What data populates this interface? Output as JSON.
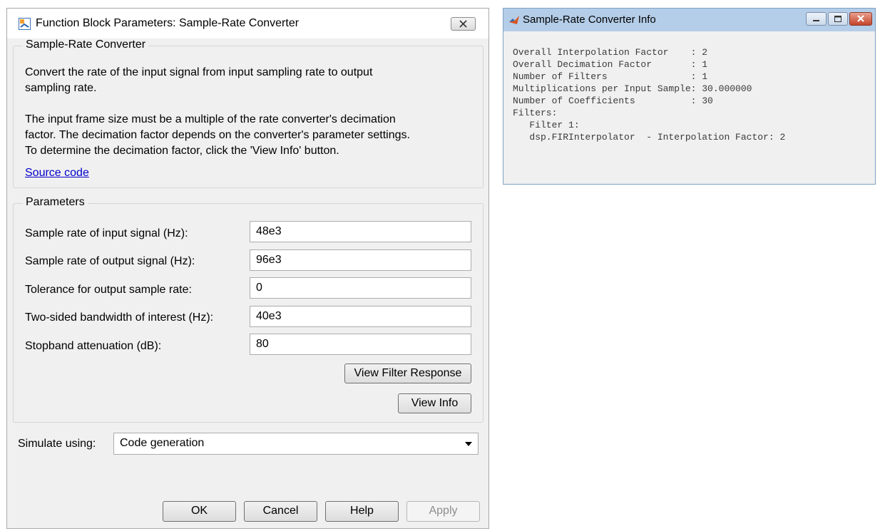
{
  "dialog": {
    "title": "Function Block Parameters: Sample-Rate Converter",
    "description_group": {
      "title": "Sample-Rate Converter",
      "paragraph1_line1": "Convert the rate of the input signal from input sampling rate to output",
      "paragraph1_line2": "sampling rate.",
      "paragraph2_line1": "The input frame size must be a multiple of the rate converter's decimation",
      "paragraph2_line2": "factor. The decimation factor depends on the converter's parameter settings.",
      "paragraph2_line3": "To determine the decimation factor, click the 'View Info' button.",
      "source_link": "Source code"
    },
    "parameters_group": {
      "title": "Parameters",
      "fields": [
        {
          "label": "Sample rate of input signal (Hz):",
          "value": "48e3"
        },
        {
          "label": "Sample rate of output signal (Hz):",
          "value": "96e3"
        },
        {
          "label": "Tolerance for output sample rate:",
          "value": "0"
        },
        {
          "label": "Two-sided bandwidth of interest (Hz):",
          "value": "40e3"
        },
        {
          "label": "Stopband attenuation (dB):",
          "value": "80"
        }
      ],
      "view_filter_response_label": "View Filter Response",
      "view_info_label": "View Info"
    },
    "simulate": {
      "label": "Simulate using:",
      "selected": "Code generation"
    },
    "buttons": {
      "ok": "OK",
      "cancel": "Cancel",
      "help": "Help",
      "apply": "Apply"
    }
  },
  "info_window": {
    "title": "Sample-Rate Converter Info",
    "lines": [
      "Overall Interpolation Factor    : 2",
      "Overall Decimation Factor       : 1",
      "Number of Filters               : 1",
      "Multiplications per Input Sample: 30.000000",
      "Number of Coefficients          : 30",
      "Filters:",
      "   Filter 1:",
      "   dsp.FIRInterpolator  - Interpolation Factor: 2"
    ]
  },
  "colors": {
    "dialog_bg": "#f0f0f0",
    "link": "#0000cc",
    "info_titlebar": "#b4cde8",
    "close_red": "#c5432a"
  }
}
